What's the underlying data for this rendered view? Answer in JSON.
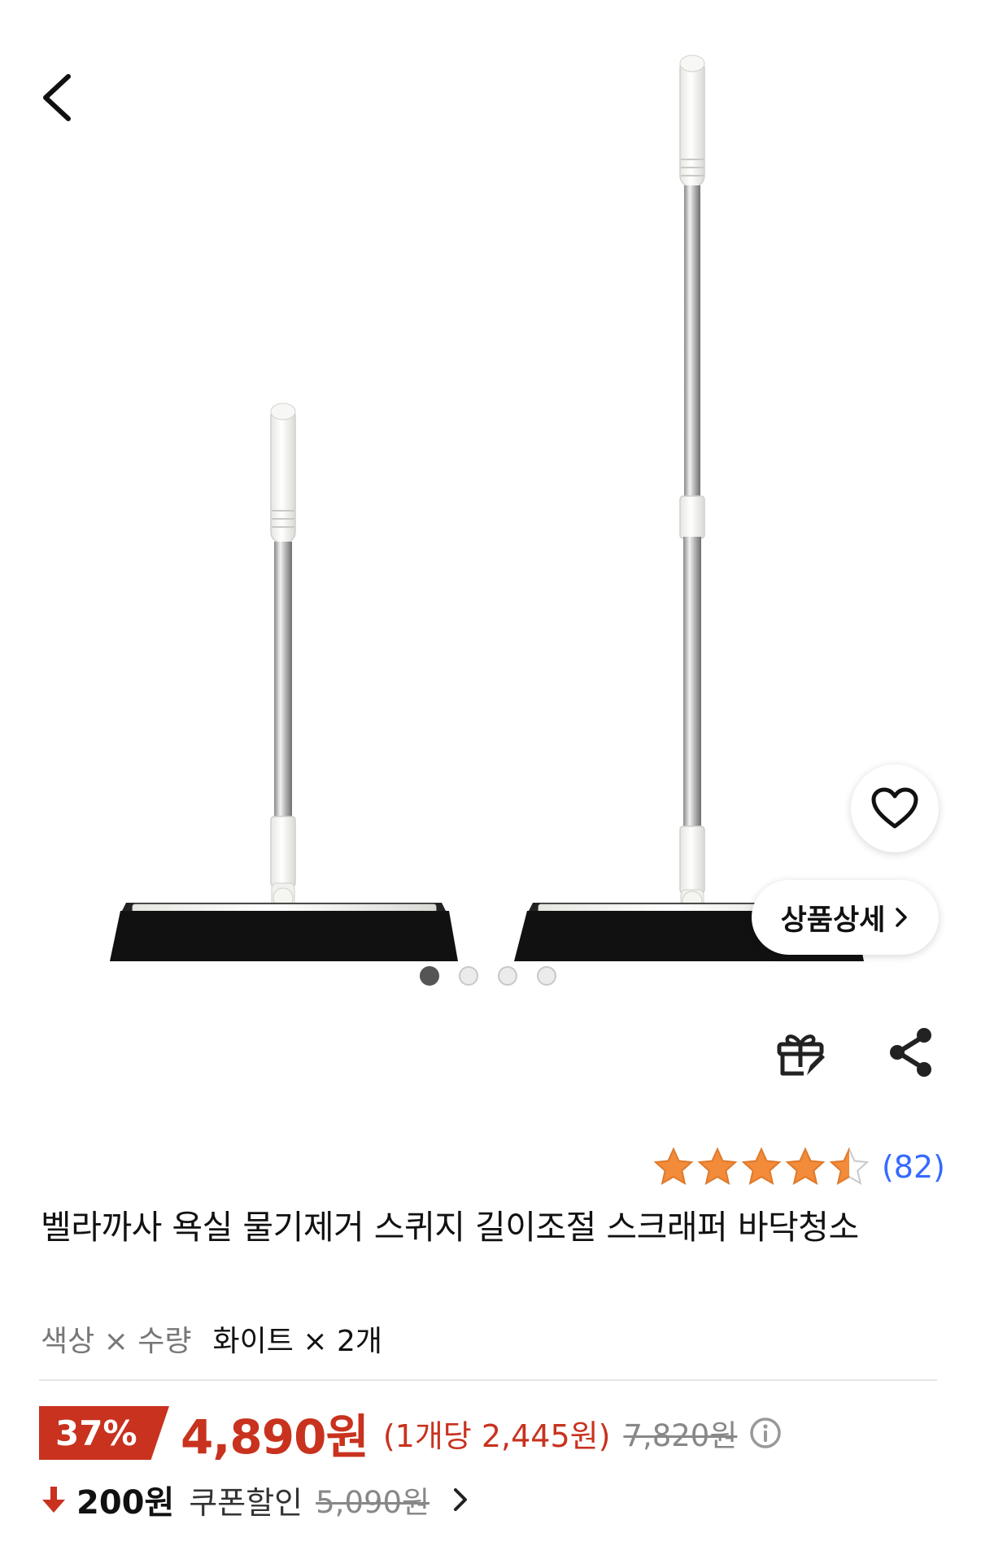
{
  "gallery": {
    "dots_total": 4,
    "active_dot": 0,
    "detail_button_label": "상품상세"
  },
  "rating": {
    "stars": 4.5,
    "review_count": "(82)"
  },
  "product": {
    "title": "벨라까사 욕실 물기제거 스퀴지 길이조절 스크래퍼 바닥청소"
  },
  "option": {
    "label": "색상 × 수량",
    "value": "화이트 × 2개"
  },
  "price": {
    "discount": "37%",
    "sale_price": "4,890원",
    "unit_price": "(1개당 2,445원)",
    "original_price": "7,820원"
  },
  "coupon": {
    "amount": "200원",
    "label": "쿠폰할인",
    "original_price": "5,090원"
  },
  "colors": {
    "accent_red": "#c8321e",
    "star_orange": "#f28b3a",
    "link_blue": "#346aff"
  },
  "icons": {
    "back": "chevron-left-icon",
    "wish": "heart-outline-icon",
    "gift": "gift-icon",
    "share": "share-icon",
    "info": "info-circle-icon",
    "coupon": "arrow-down-icon"
  }
}
